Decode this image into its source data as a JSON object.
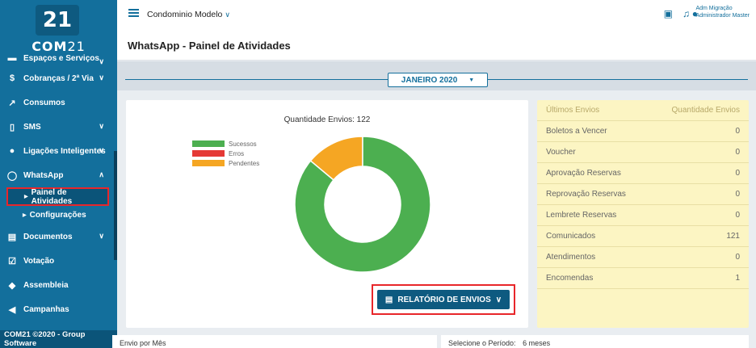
{
  "brand": {
    "logo_mark": "21",
    "logo_prefix": "COM",
    "logo_suffix": "21"
  },
  "sidebar": {
    "items": [
      {
        "label": "Espaços e Serviços",
        "icon": "sofa-icon",
        "glyph": "▬",
        "chevron": "∨"
      },
      {
        "label": "Cobranças / 2ª Via",
        "icon": "barcode-icon",
        "glyph": "$",
        "chevron": "∨"
      },
      {
        "label": "Consumos",
        "icon": "trend-icon",
        "glyph": "↗",
        "chevron": ""
      },
      {
        "label": "SMS",
        "icon": "phone-icon",
        "glyph": "▯",
        "chevron": "∨"
      },
      {
        "label": "Ligações Inteligentes",
        "icon": "mic-icon",
        "glyph": "●",
        "chevron": "∨"
      },
      {
        "label": "WhatsApp",
        "icon": "whatsapp-icon",
        "glyph": "◯",
        "chevron": "∧"
      }
    ],
    "subitems": [
      {
        "label": "Painel de Atividades"
      },
      {
        "label": "Configurações"
      }
    ],
    "items2": [
      {
        "label": "Documentos",
        "icon": "document-icon",
        "glyph": "▤",
        "chevron": "∨"
      },
      {
        "label": "Votação",
        "icon": "ballot-icon",
        "glyph": "☑",
        "chevron": ""
      },
      {
        "label": "Assembleia",
        "icon": "gavel-icon",
        "glyph": "◆",
        "chevron": ""
      },
      {
        "label": "Campanhas",
        "icon": "megaphone-icon",
        "glyph": "◀",
        "chevron": ""
      }
    ],
    "footer": "COM21 ©2020 - Group Software"
  },
  "topbar": {
    "condo_name": "Condominio Modelo",
    "user_name": "Adm Migração",
    "user_role": "Administrador Master"
  },
  "page": {
    "title": "WhatsApp - Painel de Atividades"
  },
  "month_selector": {
    "value": "JANEIRO 2020"
  },
  "chart_data": {
    "type": "pie",
    "title": "Quantidade Envios: 122",
    "series": [
      {
        "name": "Sucessos",
        "value": 105,
        "color": "#4caf50"
      },
      {
        "name": "Erros",
        "value": 0,
        "color": "#e53935"
      },
      {
        "name": "Pendentes",
        "value": 17,
        "color": "#f5a623"
      }
    ],
    "legend_position": "left"
  },
  "report_button": {
    "label": "RELATÓRIO DE ENVIOS"
  },
  "table": {
    "header": {
      "label": "Últimos Envios",
      "value": "Quantidade Envios"
    },
    "rows": [
      {
        "label": "Boletos a Vencer",
        "value": "0"
      },
      {
        "label": "Voucher",
        "value": "0"
      },
      {
        "label": "Aprovação Reservas",
        "value": "0"
      },
      {
        "label": "Reprovação Reservas",
        "value": "0"
      },
      {
        "label": "Lembrete Reservas",
        "value": "0"
      },
      {
        "label": "Comunicados",
        "value": "121"
      },
      {
        "label": "Atendimentos",
        "value": "0"
      },
      {
        "label": "Encomendas",
        "value": "1"
      }
    ]
  },
  "bottom": {
    "left_title": "Envio por Mês",
    "right_label": "Selecione o Período:",
    "right_value": "6 meses"
  }
}
